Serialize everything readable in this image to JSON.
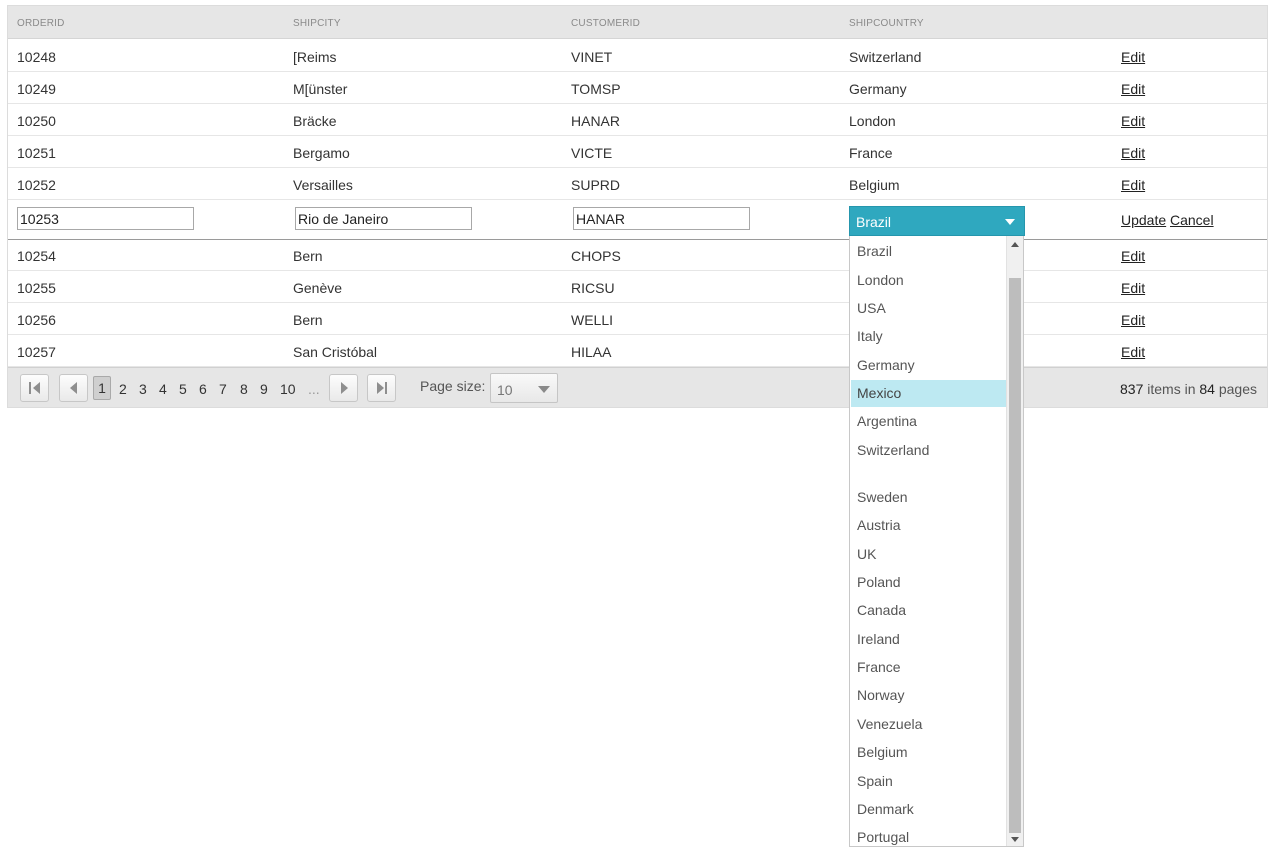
{
  "columns": [
    "ORDERID",
    "SHIPCITY",
    "CUSTOMERID",
    "SHIPCOUNTRY"
  ],
  "rows_before": [
    {
      "orderid": "10248",
      "shipcity": "[Reims",
      "customerid": "VINET",
      "shipcountry": "Switzerland",
      "action": "Edit"
    },
    {
      "orderid": "10249",
      "shipcity": "M[ünster",
      "customerid": "TOMSP",
      "shipcountry": "Germany",
      "action": "Edit"
    },
    {
      "orderid": "10250",
      "shipcity": "Bräcke",
      "customerid": "HANAR",
      "shipcountry": "London",
      "action": "Edit"
    },
    {
      "orderid": "10251",
      "shipcity": "Bergamo",
      "customerid": "VICTE",
      "shipcountry": "France",
      "action": "Edit"
    },
    {
      "orderid": "10252",
      "shipcity": "Versailles",
      "customerid": "SUPRD",
      "shipcountry": "Belgium",
      "action": "Edit"
    }
  ],
  "edit_row": {
    "orderid": "10253",
    "shipcity": "Rio de Janeiro",
    "customerid": "HANAR",
    "shipcountry": "Brazil",
    "update_label": "Update",
    "cancel_label": "Cancel"
  },
  "rows_after": [
    {
      "orderid": "10254",
      "shipcity": "Bern",
      "customerid": "CHOPS",
      "action": "Edit"
    },
    {
      "orderid": "10255",
      "shipcity": "Genève",
      "customerid": "RICSU",
      "action": "Edit"
    },
    {
      "orderid": "10256",
      "shipcity": "Bern",
      "customerid": "WELLI",
      "action": "Edit"
    },
    {
      "orderid": "10257",
      "shipcity": "San Cristóbal",
      "customerid": "HILAA",
      "action": "Edit"
    }
  ],
  "dropdown_options": [
    "Brazil",
    "London",
    "USA",
    "Italy",
    "Germany",
    "Mexico",
    "Argentina",
    "Switzerland",
    "",
    "Sweden",
    "Austria",
    "UK",
    "Poland",
    "Canada",
    "Ireland",
    "France",
    "Norway",
    "Venezuela",
    "Belgium",
    "Spain",
    "Denmark",
    "Portugal"
  ],
  "dropdown_highlighted": "Mexico",
  "pager": {
    "current_page": "1",
    "pages": [
      "2",
      "3",
      "4",
      "5",
      "6",
      "7",
      "8",
      "9",
      "10"
    ],
    "ellipsis": "...",
    "page_size_label": "Page size:",
    "page_size": "10",
    "total_items": "837",
    "items_in_label": "items in",
    "total_pages": "84",
    "pages_label": "pages"
  },
  "colors": {
    "accent": "#2fa8bf",
    "highlight": "#bde9f2",
    "header_bg": "#e6e6e6"
  }
}
